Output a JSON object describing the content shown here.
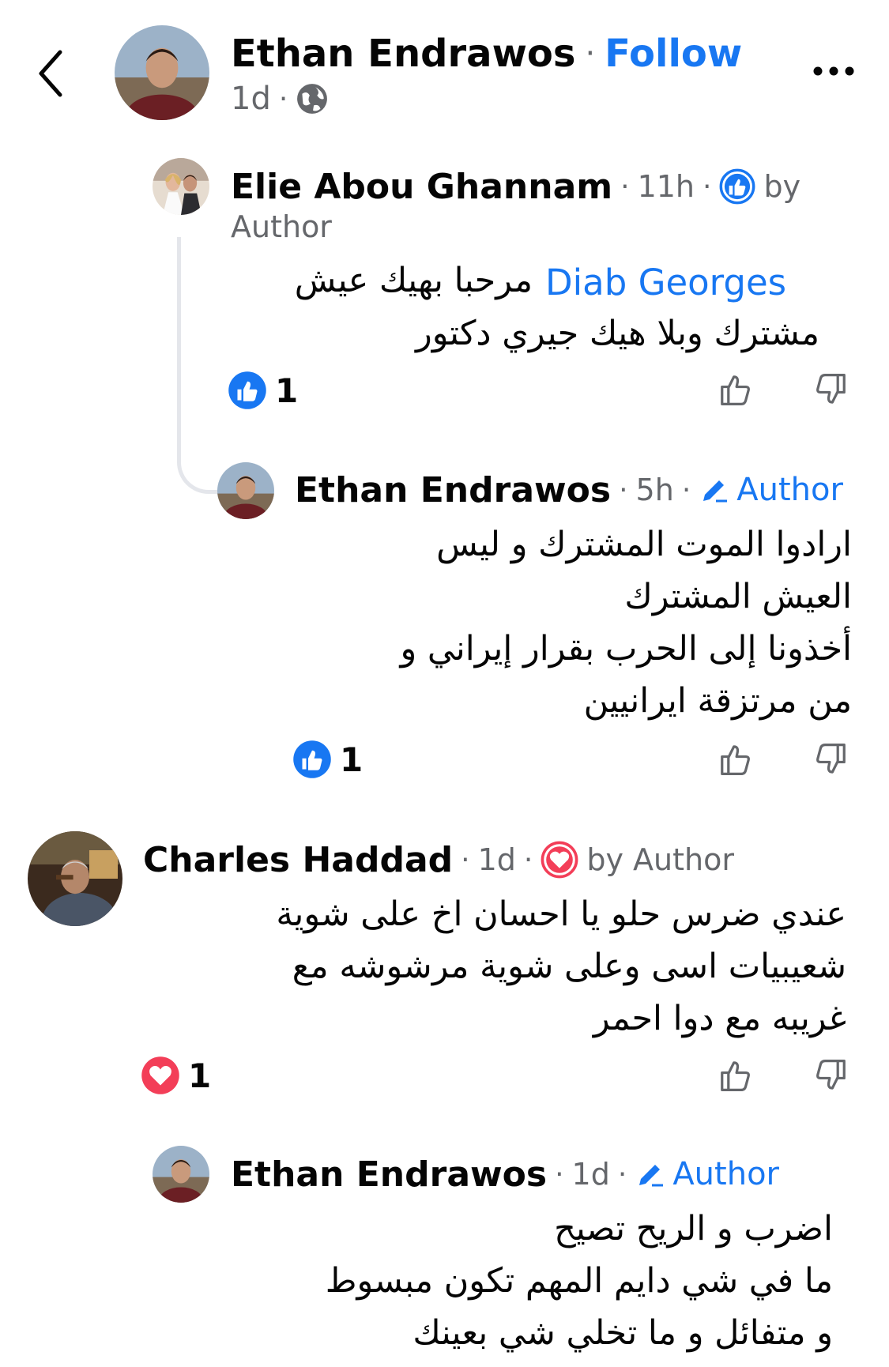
{
  "header": {
    "back_icon": "chevron-left-icon",
    "author": "Ethan Endrawos",
    "separator": "·",
    "follow_label": "Follow",
    "time": "1d",
    "time_separator": "·",
    "privacy_icon": "globe-icon",
    "more_icon": "more-horizontal-icon"
  },
  "comments": [
    {
      "author": "Elie Abou Ghannam",
      "time": "11h",
      "badge_icon": "thumbs-up-circle-icon",
      "badge_label": "by",
      "badge_label2": "Author",
      "mention": "Diab Georges",
      "text_line1": "مرحبا بهيك عيش",
      "text_line2": "مشترك وبلا هيك جيري دكتور",
      "reaction_icon": "like-reaction-icon",
      "reaction_count": "1"
    },
    {
      "author": "Ethan Endrawos",
      "time": "5h",
      "author_badge": "Author",
      "lines": [
        "ارادوا الموت المشترك و ليس",
        "العيش المشترك",
        "أخذونا إلى الحرب بقرار إيراني و",
        "من مرتزقة ايرانيين"
      ],
      "reaction_icon": "like-reaction-icon",
      "reaction_count": "1"
    },
    {
      "author": "Charles Haddad",
      "time": "1d",
      "badge_icon": "heart-circle-icon",
      "badge_label": "by Author",
      "lines": [
        "عندي ضرس حلو  يا احسان اخ على شوية",
        "شعيبيات اسى وعلى شوية مرشوشه مع",
        "غريبه مع دوا احمر"
      ],
      "reaction_icon": "love-reaction-icon",
      "reaction_count": "1"
    },
    {
      "author": "Ethan Endrawos",
      "time": "1d",
      "author_badge": "Author",
      "lines": [
        "اضرب و الريح تصيح",
        "ما في شي دايم المهم تكون مبسوط",
        "و متفائل و ما تخلي شي بعينك"
      ]
    }
  ],
  "colors": {
    "brand_blue": "#1877f2",
    "meta_gray": "#65676b",
    "love_red": "#f33e58"
  }
}
